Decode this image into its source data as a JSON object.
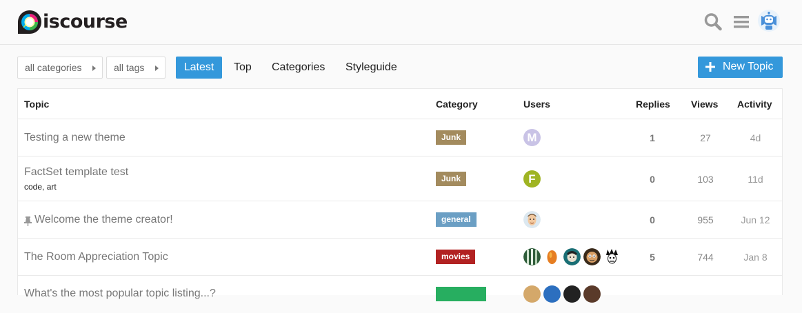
{
  "brand": {
    "logo_text": "iscourse"
  },
  "colors": {
    "accent": "#3498db",
    "junk": "#a38b5e",
    "general": "#6b9fc4",
    "movies": "#b22222",
    "green": "#27ae60"
  },
  "header": {
    "icons": [
      "search-icon",
      "menu-icon",
      "avatar-icon"
    ]
  },
  "nav": {
    "all_categories": "all categories",
    "all_tags": "all tags",
    "tabs": [
      {
        "label": "Latest",
        "active": true
      },
      {
        "label": "Top"
      },
      {
        "label": "Categories"
      },
      {
        "label": "Styleguide"
      }
    ],
    "new_topic": "New Topic"
  },
  "table": {
    "headers": {
      "topic": "Topic",
      "category": "Category",
      "users": "Users",
      "replies": "Replies",
      "views": "Views",
      "activity": "Activity"
    },
    "rows": [
      {
        "title": "Testing a new theme",
        "tags": [],
        "category": "Junk",
        "users": [
          "M"
        ],
        "replies": "1",
        "views": "27",
        "activity": "4d"
      },
      {
        "title": "FactSet template test",
        "tags": [
          "code",
          "art"
        ],
        "category": "Junk",
        "users": [
          "F"
        ],
        "replies": "0",
        "views": "103",
        "activity": "11d"
      },
      {
        "title": "Welcome the theme creator!",
        "pinned": true,
        "tags": [],
        "category": "general",
        "users": [
          "avatar"
        ],
        "replies": "0",
        "views": "955",
        "activity": "Jun 12"
      },
      {
        "title": "The Room Appreciation Topic",
        "tags": [],
        "category": "movies",
        "users": [
          "a1",
          "a2",
          "a3",
          "a4",
          "a5"
        ],
        "replies": "5",
        "views": "744",
        "activity": "Jan 8"
      },
      {
        "title": "What's the most popular topic listing...?",
        "tags": [],
        "category": "",
        "users": [],
        "replies": "",
        "views": "",
        "activity": ""
      }
    ]
  }
}
